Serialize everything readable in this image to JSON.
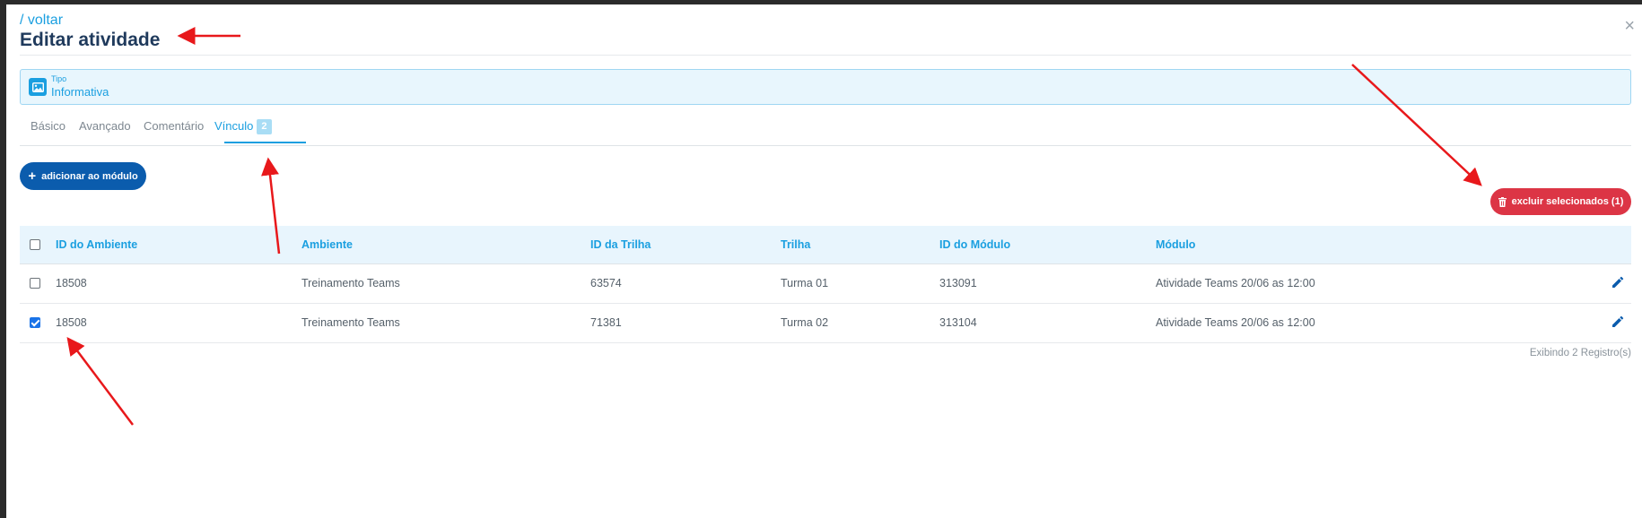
{
  "header": {
    "back_label": "/ voltar",
    "title": "Editar atividade",
    "close_icon": "×"
  },
  "type_box": {
    "label": "Tipo",
    "value": "Informativa",
    "icon": "image-icon"
  },
  "tabs": [
    {
      "label": "Básico",
      "active": false
    },
    {
      "label": "Avançado",
      "active": false
    },
    {
      "label": "Comentário",
      "active": false
    },
    {
      "label": "Vínculo",
      "active": true,
      "badge": "2"
    }
  ],
  "actions": {
    "add_label": "adicionar ao módulo",
    "delete_label": "excluir selecionados (1)"
  },
  "table": {
    "columns": [
      "ID do Ambiente",
      "Ambiente",
      "ID da Trilha",
      "Trilha",
      "ID do Módulo",
      "Módulo"
    ],
    "rows": [
      {
        "checked": false,
        "cells": [
          "18508",
          "Treinamento Teams",
          "63574",
          "Turma 01",
          "313091",
          "Atividade Teams 20/06 as 12:00"
        ]
      },
      {
        "checked": true,
        "cells": [
          "18508",
          "Treinamento Teams",
          "71381",
          "Turma 02",
          "313104",
          "Atividade Teams 20/06 as 12:00"
        ]
      }
    ],
    "footer": "Exibindo 2 Registro(s)"
  },
  "colors": {
    "accent": "#1a9fe0",
    "primary_button": "#0b5cad",
    "danger_button": "#dc3545",
    "annotation_arrow": "#e8181b"
  }
}
